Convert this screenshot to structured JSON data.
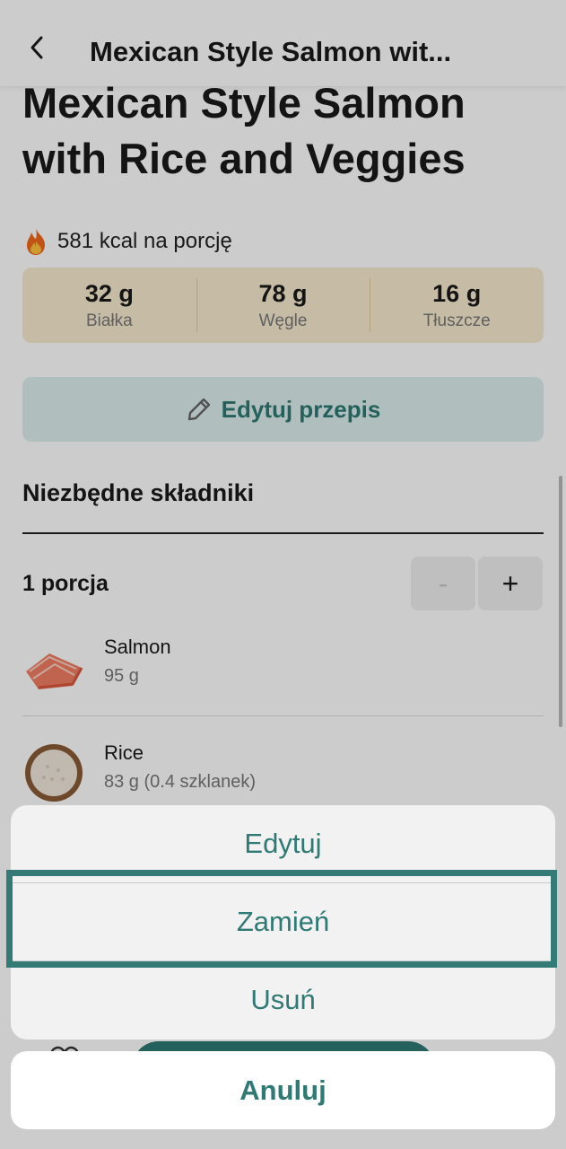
{
  "nav": {
    "title": "Mexican Style Salmon wit..."
  },
  "recipe": {
    "title": "Mexican Style Salmon with Rice and Veggies",
    "kcal": "581 kcal na porcję"
  },
  "macros": [
    {
      "value": "32 g",
      "label": "Białka"
    },
    {
      "value": "78 g",
      "label": "Węgle"
    },
    {
      "value": "16 g",
      "label": "Tłuszcze"
    }
  ],
  "edit_recipe_label": "Edytuj przepis",
  "ingredients_section": {
    "title": "Niezbędne składniki",
    "servings": "1 porcja",
    "minus": "-",
    "plus": "+",
    "items": [
      {
        "name": "Salmon",
        "amount": "95 g"
      },
      {
        "name": "Rice",
        "amount": "83 g (0.4 szklanek)"
      }
    ]
  },
  "action_sheet": {
    "edit": "Edytuj",
    "replace": "Zamień",
    "delete": "Usuń",
    "cancel": "Anuluj"
  },
  "colors": {
    "accent": "#2f7a74",
    "macro_bg": "#f8ecd0",
    "edit_bg": "#dcefee"
  }
}
